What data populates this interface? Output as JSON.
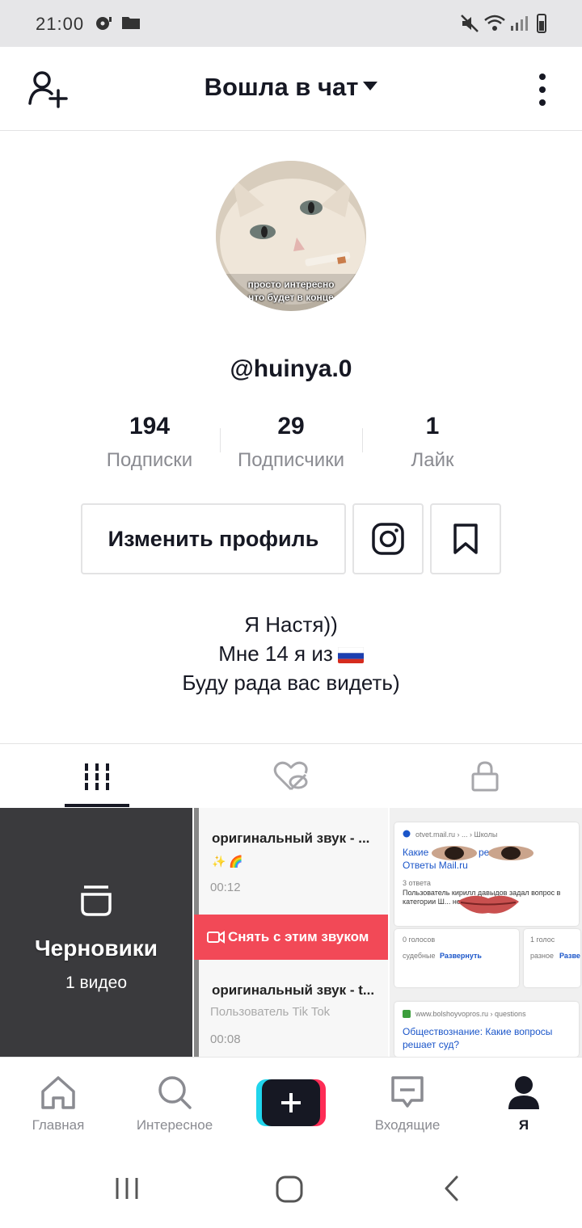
{
  "status_bar": {
    "time": "21:00"
  },
  "header": {
    "title": "Вошла в чат"
  },
  "profile": {
    "avatar_caption_line1": "просто интересно",
    "avatar_caption_line2": "что будет в конце",
    "username": "@huinya.0",
    "stats": [
      {
        "value": "194",
        "label": "Подписки"
      },
      {
        "value": "29",
        "label": "Подписчики"
      },
      {
        "value": "1",
        "label": "Лайк"
      }
    ],
    "edit_button": "Изменить профиль",
    "bio_line1": "Я Настя))",
    "bio_line2": "Мне 14 я из",
    "bio_line3": "Буду рада вас видеть)"
  },
  "tabs": [
    {
      "icon": "grid-icon",
      "active": true
    },
    {
      "icon": "liked-hidden-icon",
      "active": false
    },
    {
      "icon": "lock-icon",
      "active": false
    }
  ],
  "grid": {
    "drafts": {
      "title": "Черновики",
      "count": "1 видео"
    },
    "video2": {
      "sound1": "оригинальный звук - ...",
      "duration1": "00:12",
      "button": "Снять с этим звуком",
      "sound2": "оригинальный звук - t...",
      "user2": "Пользователь Tik Tok",
      "duration2": "00:08"
    },
    "video3": {
      "site1": "otvet.mail.ru › ... › Школы",
      "link1a": "Какие",
      "link1b": "реша",
      "link1c": "Ответы Mail.ru",
      "answers": "3 ответа",
      "body": "Пользователь кирилл давыдов задал вопрос в категории Ш... него 3 ответа.",
      "votes1": "0 голосов",
      "tag1": "судебные",
      "expand1": "Развернуть",
      "votes2": "1 голос",
      "tag2": "разное",
      "expand2": "Разве",
      "site2": "www.bolshoyvopros.ru › questions",
      "link2a": "Обществознание: Какие вопросы",
      "link2b": "решает суд?"
    }
  },
  "bottom_nav": [
    {
      "label": "Главная",
      "icon": "home-icon"
    },
    {
      "label": "Интересное",
      "icon": "search-icon"
    },
    {
      "label": "",
      "icon": "create-icon"
    },
    {
      "label": "Входящие",
      "icon": "inbox-icon"
    },
    {
      "label": "Я",
      "icon": "profile-icon",
      "active": true
    }
  ]
}
